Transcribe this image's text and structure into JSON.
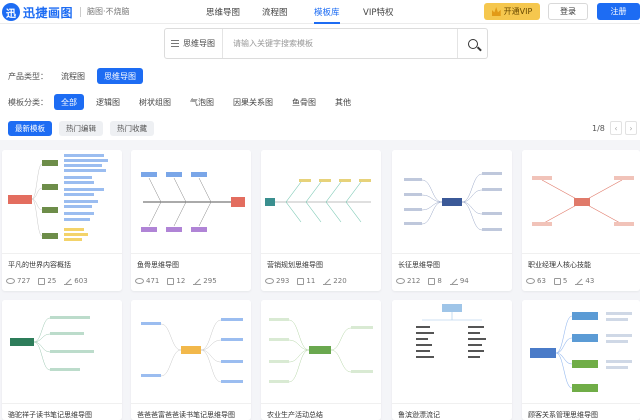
{
  "header": {
    "logo_text": "迅捷画图",
    "logo_mark": "迅",
    "slogan": "脑图·不烧脑",
    "nav": [
      {
        "label": "思维导图"
      },
      {
        "label": "流程图"
      },
      {
        "label": "模板库"
      },
      {
        "label": "VIP特权"
      }
    ],
    "vip_label": "开通VIP",
    "login_label": "登录",
    "register_label": "注册"
  },
  "search": {
    "type_label": "思维导图",
    "placeholder": "请输入关键字搜索模板"
  },
  "filters": {
    "product_label": "产品类型：",
    "product_options": [
      "流程图",
      "思维导图"
    ],
    "product_selected": "思维导图",
    "category_label": "模板分类：",
    "category_options": [
      "全部",
      "逻辑图",
      "树状组图",
      "气泡图",
      "因果关系图",
      "鱼骨图",
      "其他"
    ],
    "category_selected": "全部"
  },
  "sort_tabs": [
    {
      "label": "最新模板"
    },
    {
      "label": "热门编辑"
    },
    {
      "label": "热门收藏"
    }
  ],
  "sort_selected": "最新模板",
  "pagination": {
    "text": "1/8",
    "prev": "‹",
    "next": "›"
  },
  "cards_row1": [
    {
      "title": "平凡的世界内容概括",
      "views": "727",
      "likes": "25",
      "edits": "603"
    },
    {
      "title": "鱼骨思维导图",
      "views": "471",
      "likes": "12",
      "edits": "295"
    },
    {
      "title": "营销规划思维导图",
      "views": "293",
      "likes": "11",
      "edits": "220"
    },
    {
      "title": "长征思维导图",
      "views": "212",
      "likes": "8",
      "edits": "94"
    },
    {
      "title": "职业经理人核心技能",
      "views": "63",
      "likes": "5",
      "edits": "43"
    }
  ],
  "cards_row2": [
    {
      "title": "骆驼祥子读书笔记思维导图"
    },
    {
      "title": "爸爸爸富爸爸读书笔记思维导图"
    },
    {
      "title": "农业生产活动总结"
    },
    {
      "title": "鲁滨逊漂流记"
    },
    {
      "title": "顾客关系管理思维导图"
    }
  ],
  "icons": {
    "view": "eye-icon",
    "like": "like-icon",
    "edit": "edit-icon"
  },
  "colors": {
    "accent": "#1d6cf3",
    "vip": "#f5c74e",
    "page_bg": "#f4f5f8"
  }
}
